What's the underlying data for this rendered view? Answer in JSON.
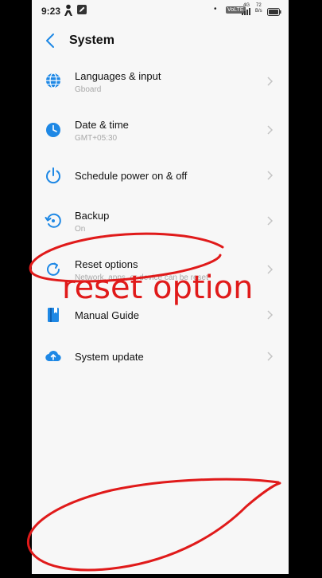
{
  "status_bar": {
    "time": "9:23",
    "volte": "VoLTE",
    "network": "4G",
    "speed_value": "72",
    "speed_unit": "B/s"
  },
  "header": {
    "title": "System",
    "back_icon": "chevron-left-icon"
  },
  "settings": [
    {
      "label": "Languages & input",
      "sub": "Gboard",
      "icon": "globe-icon"
    },
    {
      "label": "Date & time",
      "sub": "GMT+05:30",
      "icon": "clock-icon"
    },
    {
      "label": "Schedule power on & off",
      "sub": "",
      "icon": "power-icon"
    },
    {
      "label": "Backup",
      "sub": "On",
      "icon": "backup-icon"
    },
    {
      "label": "Reset options",
      "sub": "Network, apps, or device can be reset",
      "icon": "reset-icon"
    },
    {
      "label": "Manual Guide",
      "sub": "",
      "icon": "book-icon"
    },
    {
      "label": "System update",
      "sub": "",
      "icon": "cloud-upload-icon"
    }
  ],
  "annotation": {
    "text": "reset option",
    "color": "#e01a1a"
  },
  "colors": {
    "accent": "#1e88e5",
    "background": "#f7f7f7",
    "chevron": "#c4c4c4"
  }
}
